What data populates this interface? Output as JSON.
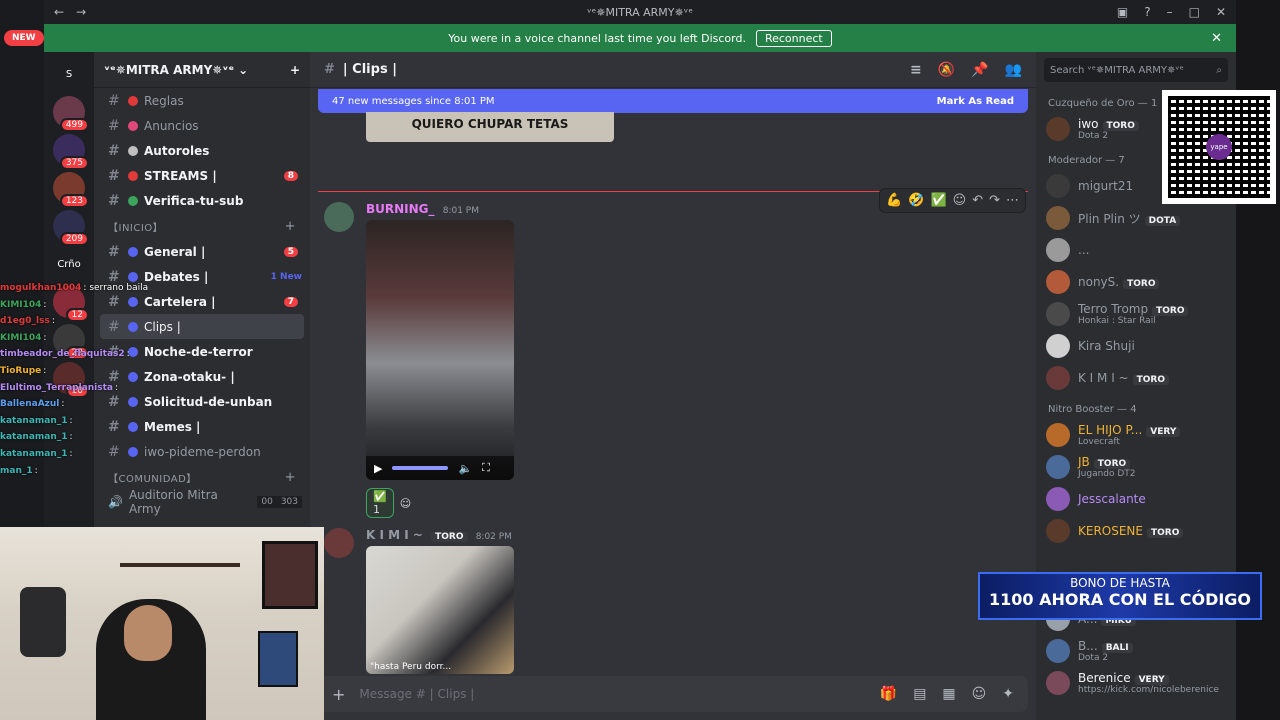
{
  "window": {
    "title": "ᵛᵉ✵MITRA ARMY✵ᵛᵉ"
  },
  "banner": {
    "text": "You were in a voice channel last time you left Discord.",
    "button": "Reconnect"
  },
  "guilds": {
    "new_label": "NEW",
    "items": [
      {
        "label": "S",
        "badge": "",
        "color": "#1e1f22"
      },
      {
        "label": "",
        "badge": "499",
        "color": "#6b3a4a"
      },
      {
        "label": "",
        "badge": "375",
        "color": "#3a2d5e"
      },
      {
        "label": "",
        "badge": "123",
        "color": "#7a3b2e"
      },
      {
        "label": "",
        "badge": "209",
        "color": "#2e2e4e"
      },
      {
        "label": "Crño",
        "badge": "",
        "color": "#1e1f22"
      },
      {
        "label": "",
        "badge": "12",
        "color": "#8a2b3a"
      },
      {
        "label": "",
        "badge": "22",
        "color": "#3a3a3a"
      },
      {
        "label": "",
        "badge": "10",
        "color": "#5a2b2b"
      }
    ]
  },
  "server": {
    "name": "ᵛᵉ✵MITRA ARMY✵ᵛᵉ"
  },
  "channels_top": [
    {
      "name": "Reglas",
      "unread": false,
      "badge": "",
      "emoji_color": "#e03a3a"
    },
    {
      "name": "Anuncios",
      "unread": false,
      "badge": "",
      "emoji_color": "#e0487a"
    },
    {
      "name": "Autoroles",
      "unread": true,
      "badge": "",
      "emoji_color": "#c0c0c0"
    },
    {
      "name": "STREAMS |",
      "unread": true,
      "badge": "8",
      "emoji_color": "#e03a3a"
    },
    {
      "name": "Verifica-tu-sub",
      "unread": true,
      "badge": "",
      "emoji_color": "#3ba55c"
    }
  ],
  "category_inicio": "【INICIO】",
  "channels_inicio": [
    {
      "name": "General |",
      "unread": true,
      "badge": "5",
      "new": ""
    },
    {
      "name": "Debates |",
      "unread": true,
      "badge": "",
      "new": "1 New"
    },
    {
      "name": "Cartelera |",
      "unread": true,
      "badge": "7",
      "new": ""
    },
    {
      "name": "Clips |",
      "unread": false,
      "badge": "",
      "new": ""
    },
    {
      "name": "Noche-de-terror",
      "unread": true,
      "badge": "",
      "new": ""
    },
    {
      "name": "Zona-otaku- |",
      "unread": true,
      "badge": "",
      "new": ""
    },
    {
      "name": "Solicitud-de-unban",
      "unread": true,
      "badge": "",
      "new": ""
    },
    {
      "name": "Memes |",
      "unread": true,
      "badge": "",
      "new": ""
    },
    {
      "name": "iwo-pideme-perdon",
      "unread": false,
      "badge": "",
      "new": ""
    }
  ],
  "category_comunidad": "【COMUNIDAD】",
  "voice_channel": {
    "name": "Auditorio Mitra Army",
    "count_a": "00",
    "count_b": "303"
  },
  "channel": {
    "name": "| Clips |"
  },
  "newbar": {
    "text": "47 new messages since 8:01 PM",
    "mark": "Mark As Read"
  },
  "top_image_caption": "QUIERO CHUPAR TETAS",
  "messages": [
    {
      "author": "BURNING_",
      "time": "8:01 PM",
      "color": "#e879f9",
      "reaction_count": "1"
    },
    {
      "author": "K I M I ~",
      "tag": "TORO",
      "time": "8:02 PM",
      "color": "#949ba4",
      "caption": "\"hasta Peru dorr..."
    }
  ],
  "composer": {
    "placeholder": "Message # | Clips |"
  },
  "search": {
    "placeholder": "Search ᵛᵉ✵MITRA ARMY✵ᵛᵉ"
  },
  "member_groups": [
    {
      "title": "Cuzqueño de Oro — 1",
      "members": [
        {
          "name": "iwo",
          "tag": "TORO",
          "sub": "Dota 2",
          "color": "#f2f3f5",
          "av": "#5a3a2a"
        }
      ]
    },
    {
      "title": "Moderador — 7",
      "members": [
        {
          "name": "migurt21",
          "tag": "",
          "sub": "",
          "color": "#949ba4",
          "av": "#3a3a3a"
        },
        {
          "name": "Plin Plin ツ",
          "tag": "DOTA",
          "sub": "",
          "color": "#949ba4",
          "av": "#7a5a3a"
        },
        {
          "name": "...",
          "tag": "",
          "sub": "",
          "color": "#949ba4",
          "av": "#9a9a9a"
        },
        {
          "name": "nonyS.",
          "tag": "TORO",
          "sub": "",
          "color": "#949ba4",
          "av": "#b35a3a"
        },
        {
          "name": "Terro Tromp",
          "tag": "TORO",
          "sub": "Honkai : Star Rail",
          "color": "#949ba4",
          "av": "#4a4a4a"
        },
        {
          "name": "Kira Shuji",
          "tag": "",
          "sub": "",
          "color": "#949ba4",
          "av": "#d0d0d0"
        },
        {
          "name": "K I M I ~",
          "tag": "TORO",
          "sub": "",
          "color": "#949ba4",
          "av": "#6a3a3a"
        }
      ]
    },
    {
      "title": "Nitro Booster — 4",
      "members": [
        {
          "name": "EL HIJO P...",
          "tag": "VERY",
          "sub": "Lovecraft",
          "color": "#f0b232",
          "av": "#b86a2a"
        },
        {
          "name": "JB",
          "tag": "TORO",
          "sub": "Jugando DT2",
          "color": "#f0b232",
          "av": "#4a6a9a"
        },
        {
          "name": "Jesscalante",
          "tag": "",
          "sub": "",
          "color": "#b58cf5",
          "av": "#8a5ab5"
        },
        {
          "name": "KEROSENE",
          "tag": "TORO",
          "sub": "",
          "color": "#f0b232",
          "av": "#5a3a2a"
        }
      ]
    },
    {
      "title": "",
      "members": [
        {
          "name": "A...",
          "tag": "MIKU",
          "sub": "",
          "color": "#949ba4",
          "av": "#9aa0aa"
        },
        {
          "name": "B...",
          "tag": "BALI",
          "sub": "Dota 2",
          "color": "#949ba4",
          "av": "#4a6a9a"
        },
        {
          "name": "Berenice",
          "tag": "VERY",
          "sub": "https://kick.com/nicoleberenice",
          "color": "#f2f3f5",
          "av": "#7a4a5a"
        }
      ]
    }
  ],
  "qr": {
    "brand": "yape"
  },
  "promo": {
    "line1": "BONO DE HASTA",
    "line2": "1100 AHORA CON EL CÓDIGO"
  },
  "chat_overlay": [
    {
      "user": "mogulkhan1004",
      "text": ": serrano baila",
      "color": "#e03a3a"
    },
    {
      "user": "KIMI104",
      "text": ":",
      "color": "#3ba55c"
    },
    {
      "user": "d1eg0_lss",
      "text": ":",
      "color": "#e03a3a"
    },
    {
      "user": "KIMI104",
      "text": ":",
      "color": "#3ba55c"
    },
    {
      "user": "timbeador_de_flaquitas2",
      "text": ":",
      "color": "#b58cf5"
    },
    {
      "user": "TioRupe",
      "text": ":",
      "color": "#f0b232"
    },
    {
      "user": "Elultimo_Terraplanista",
      "text": ":",
      "color": "#b58cf5"
    },
    {
      "user": "BallenaAzul",
      "text": ":",
      "color": "#5aa0f0"
    },
    {
      "user": "katanaman_1",
      "text": ":",
      "color": "#3bb5b5"
    },
    {
      "user": "katanaman_1",
      "text": ":",
      "color": "#3bb5b5"
    },
    {
      "user": "katanaman_1",
      "text": ":",
      "color": "#3bb5b5"
    },
    {
      "user": "man_1",
      "text": ":",
      "color": "#3bb5b5"
    }
  ]
}
